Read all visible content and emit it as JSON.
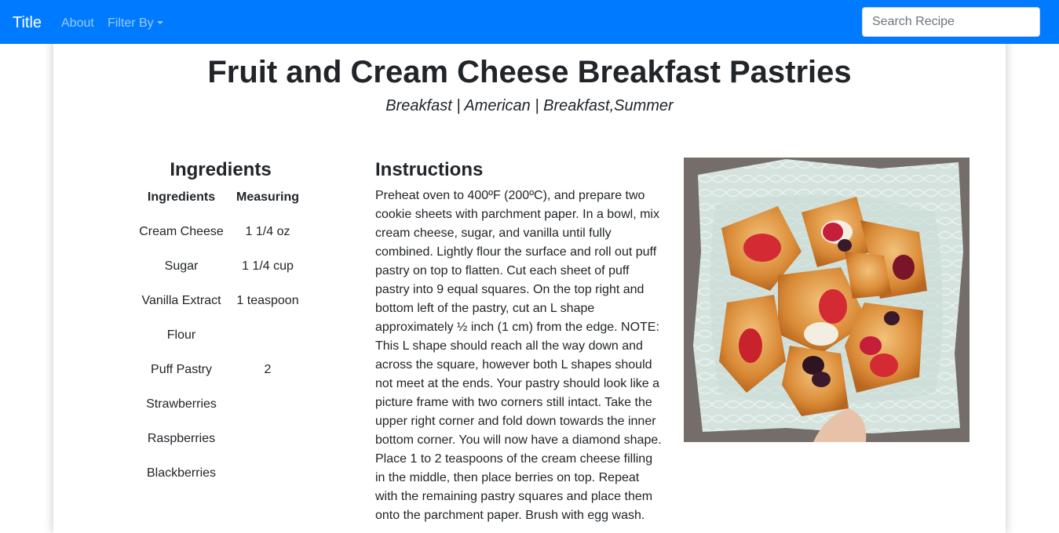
{
  "navbar": {
    "brand": "Title",
    "links": [
      "About",
      "Filter By"
    ],
    "search_placeholder": "Search Recipe"
  },
  "recipe": {
    "title": "Fruit and Cream Cheese Breakfast Pastries",
    "subtitle": "Breakfast | American | Breakfast,Summer",
    "ingredients_heading": "Ingredients",
    "table_headers": [
      "Ingredients",
      "Measuring"
    ],
    "ingredients": [
      {
        "name": "Cream Cheese",
        "measure": "1 1/4 oz"
      },
      {
        "name": "Sugar",
        "measure": "1 1/4 cup"
      },
      {
        "name": "Vanilla Extract",
        "measure": "1 teaspoon"
      },
      {
        "name": "Flour",
        "measure": ""
      },
      {
        "name": "Puff Pastry",
        "measure": "2"
      },
      {
        "name": "Strawberries",
        "measure": ""
      },
      {
        "name": "Raspberries",
        "measure": ""
      },
      {
        "name": "Blackberries",
        "measure": ""
      }
    ],
    "instructions_heading": "Instructions",
    "instructions": "Preheat oven to 400ºF (200ºC), and prepare two cookie sheets with parchment paper. In a bowl, mix cream cheese, sugar, and vanilla until fully combined. Lightly flour the surface and roll out puff pastry on top to flatten. Cut each sheet of puff pastry into 9 equal squares. On the top right and bottom left of the pastry, cut an L shape approximately ½ inch (1 cm) from the edge. NOTE: This L shape should reach all the way down and across the square, however both L shapes should not meet at the ends. Your pastry should look like a picture frame with two corners still intact. Take the upper right corner and fold down towards the inner bottom corner. You will now have a diamond shape. Place 1 to 2 teaspoons of the cream cheese filling in the middle, then place berries on top. Repeat with the remaining pastry squares and place them onto the parchment paper. Brush with egg wash."
  },
  "colors": {
    "navbar": "#007bff",
    "text": "#212529"
  }
}
